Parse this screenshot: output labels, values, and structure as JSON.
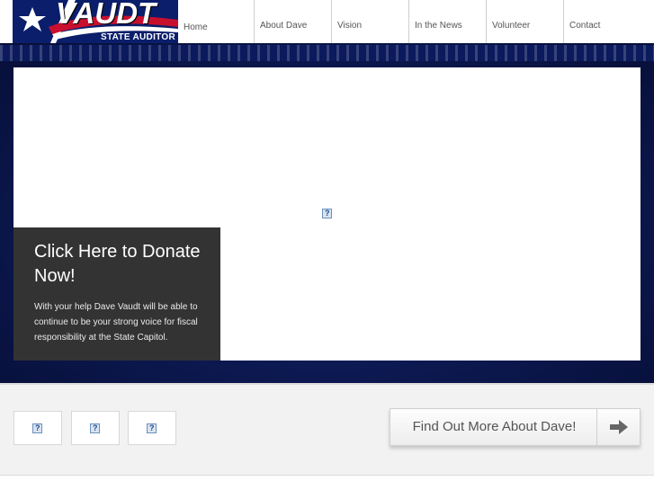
{
  "logo": {
    "brand": "VAUDT",
    "subtitle": "STATE AUDITOR",
    "icon": "flag-star-icon"
  },
  "nav": {
    "items": [
      {
        "label": "Home"
      },
      {
        "label": "About Dave"
      },
      {
        "label": "Vision"
      },
      {
        "label": "In the News"
      },
      {
        "label": "Volunteer"
      },
      {
        "label": "Contact"
      }
    ]
  },
  "slider": {
    "image_icon": "broken-image-icon"
  },
  "donate": {
    "title": "Click Here to Donate Now!",
    "text": "With your help Dave Vaudt will be able to continue to be your strong voice for fiscal responsibility at the State Capitol."
  },
  "cta": {
    "label": "Find Out More About Dave!",
    "icon": "arrow-right-icon"
  },
  "colors": {
    "navy": "#0a1646",
    "panel": "#333333",
    "text": "#555555"
  }
}
